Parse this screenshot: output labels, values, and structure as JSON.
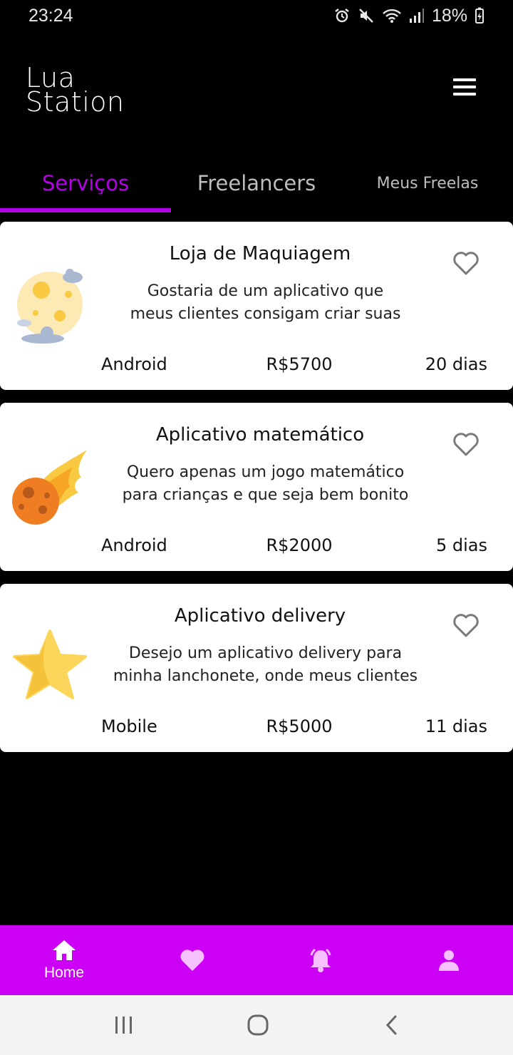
{
  "status_bar": {
    "time": "23:24",
    "battery": "18%",
    "icons": [
      "alarm-icon",
      "mute-icon",
      "wifi-icon",
      "signal-icon",
      "battery-icon"
    ]
  },
  "app": {
    "brand_line1": "Lua",
    "brand_line2": "Station",
    "menu_icon": "hamburger-menu-icon"
  },
  "tabs": [
    {
      "label": "Serviços",
      "active": true
    },
    {
      "label": "Freelancers",
      "active": false
    },
    {
      "label": "Meus Freelas",
      "active": false
    }
  ],
  "colors": {
    "accent": "#b400e6",
    "bottom_nav": "#cc00f5",
    "background": "#000000",
    "card": "#ffffff"
  },
  "cards": [
    {
      "icon": "moon-icon",
      "title": "Loja de Maquiagem",
      "desc_line1": "Gostaria de um aplicativo que",
      "desc_line2": "meus clientes consigam criar suas",
      "platform": "Android",
      "price": "R$5700",
      "days": "20 dias"
    },
    {
      "icon": "meteor-icon",
      "title": "Aplicativo matemático",
      "desc_line1": "Quero apenas um jogo matemático",
      "desc_line2": "para crianças e que seja bem bonito",
      "platform": "Android",
      "price": "R$2000",
      "days": "5 dias"
    },
    {
      "icon": "star-icon",
      "title": "Aplicativo delivery",
      "desc_line1": "Desejo um aplicativo delivery para",
      "desc_line2": "minha lanchonete, onde meus clientes",
      "platform": "Mobile",
      "price": "R$5000",
      "days": "11 dias"
    }
  ],
  "bottom_nav": [
    {
      "icon": "home-icon",
      "label": "Home",
      "active": true
    },
    {
      "icon": "heart-icon",
      "label": ""
    },
    {
      "icon": "bell-icon",
      "label": ""
    },
    {
      "icon": "person-icon",
      "label": ""
    }
  ],
  "system_nav": [
    "recents-icon",
    "home-circle-icon",
    "back-icon"
  ]
}
